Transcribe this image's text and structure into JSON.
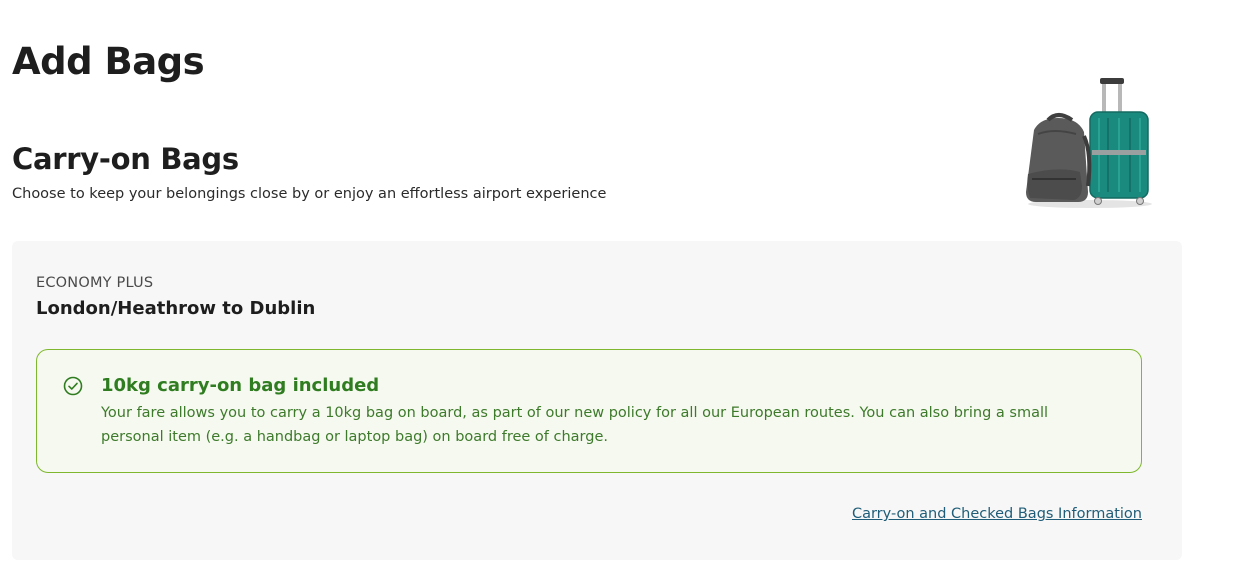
{
  "page": {
    "title": "Add Bags"
  },
  "carry_on": {
    "title": "Carry-on Bags",
    "subtitle": "Choose to keep your belongings close by or enjoy an effortless airport experience",
    "illustration_icon": "backpack-and-suitcase-icon"
  },
  "fare": {
    "cabin": "ECONOMY PLUS",
    "route": "London/Heathrow to Dublin",
    "included": {
      "icon": "check-circle-icon",
      "title": "10kg carry-on bag included",
      "text": "Your fare allows you to carry a 10kg bag on board, as part of our new policy for all our European routes. You can also bring a small personal item (e.g. a handbag or laptop bag) on board free of charge."
    },
    "info_link": "Carry-on and Checked Bags Information"
  },
  "colors": {
    "card_bg": "#f7f7f7",
    "banner_bg": "#f6f9ef",
    "banner_border": "#7fb82e",
    "banner_title": "#2f7d20",
    "link": "#1f5d78",
    "suitcase": "#1b8a7e",
    "backpack": "#5a5a5a"
  }
}
